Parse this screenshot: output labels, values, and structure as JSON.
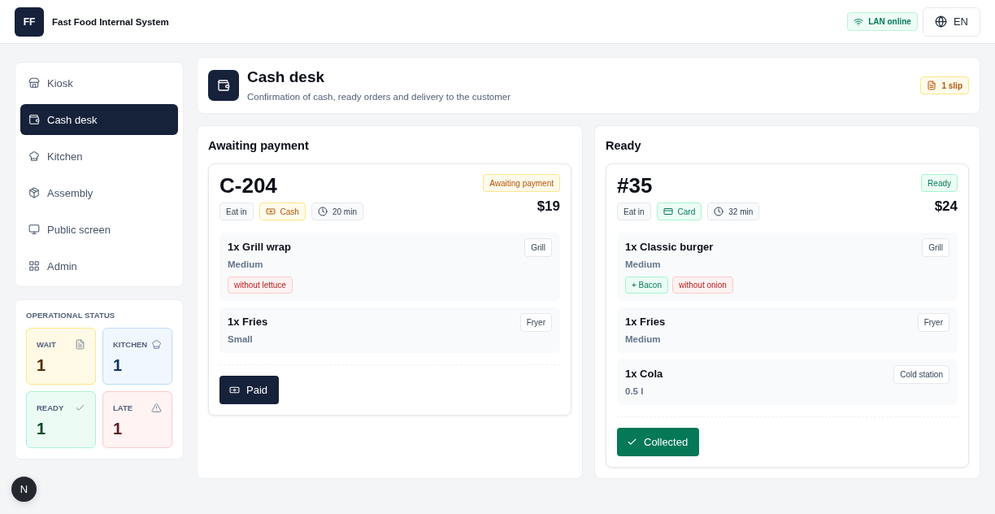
{
  "app": {
    "logo": "FF",
    "title": "Fast Food Internal System",
    "connection": {
      "label": "LAN online",
      "online": true
    },
    "language": "EN"
  },
  "sidebar": {
    "items": [
      {
        "label": "Kiosk",
        "selected": false
      },
      {
        "label": "Cash desk",
        "selected": true
      },
      {
        "label": "Kitchen",
        "selected": false
      },
      {
        "label": "Assembly",
        "selected": false
      },
      {
        "label": "Public screen",
        "selected": false
      },
      {
        "label": "Admin",
        "selected": false
      }
    ]
  },
  "operational_status": {
    "title": "OPERATIONAL STATUS",
    "tiles": [
      {
        "label": "WAIT",
        "value": "1",
        "color": "#fde68a"
      },
      {
        "label": "KITCHEN",
        "value": "1",
        "color": "#bfdbfe"
      },
      {
        "label": "READY",
        "value": "1",
        "color": "#a7f3d0"
      },
      {
        "label": "LATE",
        "value": "1",
        "color": "#fecaca"
      }
    ]
  },
  "page_header": {
    "title": "Cash desk",
    "subtitle": "Confirmation of cash, ready orders and delivery to the customer",
    "badge": "1 slip"
  },
  "columns": [
    {
      "title": "Awaiting payment",
      "orders": [
        {
          "number": "C-204",
          "status": {
            "label": "Awaiting payment",
            "kind": "awaiting"
          },
          "price": "$19",
          "service": "Eat in",
          "payment": {
            "label": "Cash",
            "kind": "cash"
          },
          "time": "20 min",
          "items": [
            {
              "name": "1x Grill wrap",
              "size": "Medium",
              "station": "Grill",
              "modifiers": [
                {
                  "label": "without lettuce",
                  "kind": "remove"
                }
              ]
            },
            {
              "name": "1x Fries",
              "size": "Small",
              "station": "Fryer"
            }
          ],
          "action": {
            "label": "Paid",
            "kind": "paid"
          }
        }
      ]
    },
    {
      "title": "Ready",
      "orders": [
        {
          "number": "#35",
          "status": {
            "label": "Ready",
            "kind": "ready"
          },
          "price": "$24",
          "service": "Eat in",
          "payment": {
            "label": "Card",
            "kind": "card"
          },
          "time": "32 min",
          "items": [
            {
              "name": "1x Classic burger",
              "size": "Medium",
              "station": "Grill",
              "modifiers": [
                {
                  "label": "+ Bacon",
                  "kind": "add"
                },
                {
                  "label": "without onion",
                  "kind": "remove"
                }
              ]
            },
            {
              "name": "1x Fries",
              "size": "Medium",
              "station": "Fryer"
            },
            {
              "name": "1x Cola",
              "size": "0.5 l",
              "station": "Cold station"
            }
          ],
          "action": {
            "label": "Collected",
            "kind": "collected"
          }
        }
      ]
    }
  ],
  "dev_indicator": "N"
}
